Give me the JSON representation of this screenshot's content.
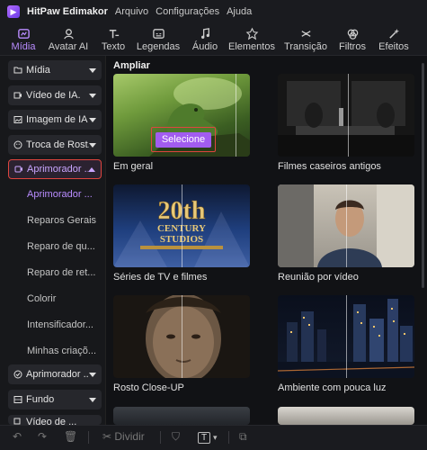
{
  "app": {
    "title": "HitPaw Edimakor",
    "menu": [
      "Arquivo",
      "Configurações",
      "Ajuda"
    ]
  },
  "toolbar": {
    "tabs": [
      {
        "label": "Mídia",
        "icon": "media-icon",
        "active": true
      },
      {
        "label": "Avatar AI",
        "icon": "avatar-icon",
        "active": false
      },
      {
        "label": "Texto",
        "icon": "text-icon",
        "active": false
      },
      {
        "label": "Legendas",
        "icon": "subtitles-icon",
        "active": false
      },
      {
        "label": "Áudio",
        "icon": "audio-icon",
        "active": false
      },
      {
        "label": "Elementos",
        "icon": "elements-icon",
        "active": false
      },
      {
        "label": "Transição",
        "icon": "transition-icon",
        "active": false
      },
      {
        "label": "Filtros",
        "icon": "filters-icon",
        "active": false
      },
      {
        "label": "Efeitos",
        "icon": "effects-icon",
        "active": false
      }
    ]
  },
  "sidebar": {
    "items": [
      {
        "label": "Mídia"
      },
      {
        "label": "Vídeo de IA."
      },
      {
        "label": "Imagem de IA"
      },
      {
        "label": "Troca de Rost..."
      },
      {
        "label": "Aprimorador ..."
      }
    ],
    "subitems": [
      {
        "label": "Aprimorador ..."
      },
      {
        "label": "Reparos Gerais"
      },
      {
        "label": "Reparo de qu..."
      },
      {
        "label": "Reparo de ret..."
      },
      {
        "label": "Colorir"
      },
      {
        "label": "Intensificador..."
      },
      {
        "label": "Minhas criaçõ..."
      }
    ],
    "bottom_items": [
      {
        "label": "Aprimorador ..."
      },
      {
        "label": "Fundo"
      },
      {
        "label": "Vídeo de ..."
      }
    ]
  },
  "main": {
    "section_title": "Ampliar",
    "select_label": "Selecione",
    "cards": [
      {
        "label": "Em geral"
      },
      {
        "label": "Filmes caseiros antigos"
      },
      {
        "label": "Séries de TV e filmes"
      },
      {
        "label": "Reunião por vídeo"
      },
      {
        "label": "Rosto Close-UP"
      },
      {
        "label": "Ambiente com pouca luz"
      }
    ]
  },
  "bottombar": {
    "split_label": "Dividir"
  }
}
